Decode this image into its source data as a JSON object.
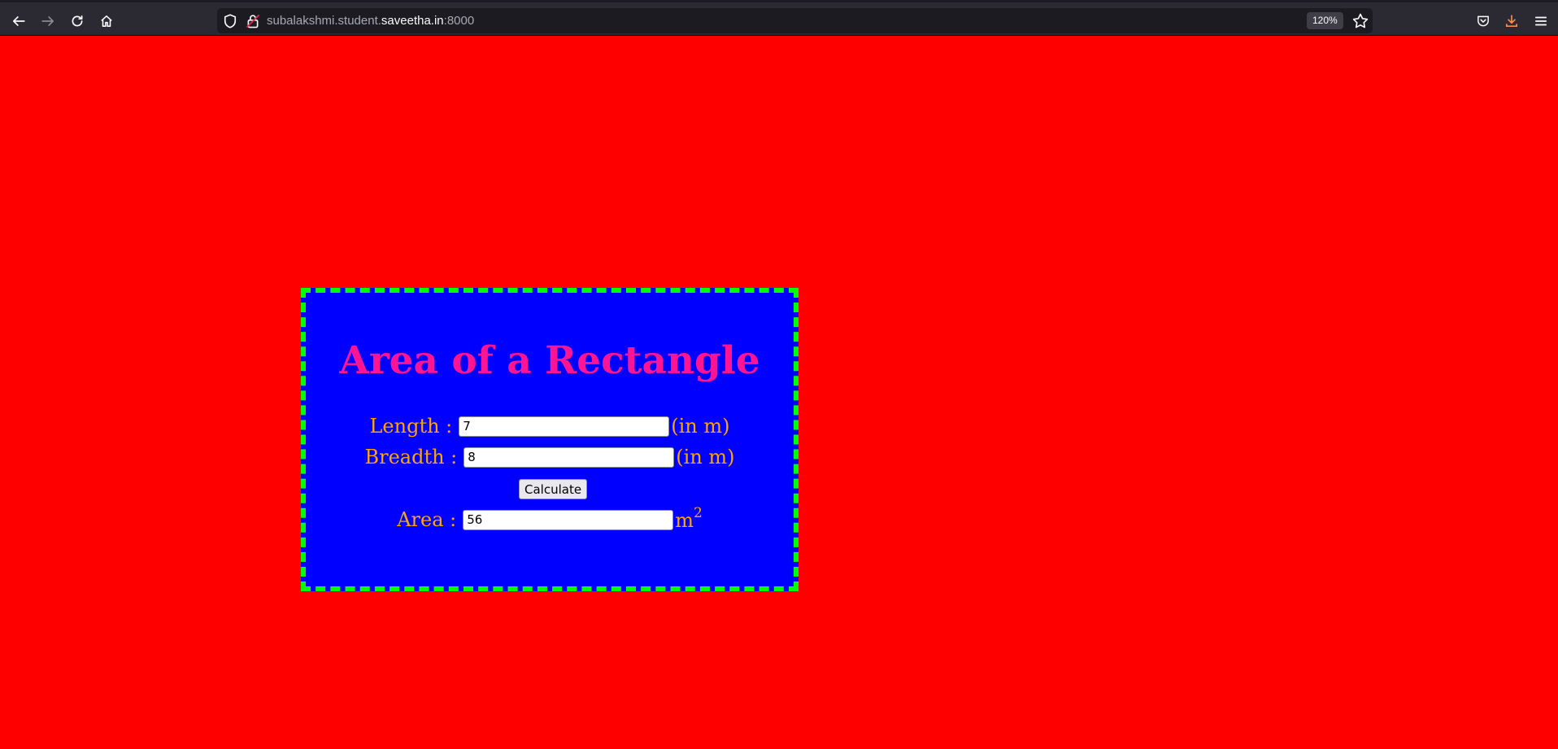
{
  "browser": {
    "url_host_prefix": "subalakshmi.student.",
    "url_host_domain": "saveetha.in",
    "url_port": ":8000",
    "zoom": "120%"
  },
  "form": {
    "title": "Area of a Rectangle",
    "length_label": "Length :",
    "length_value": "7",
    "length_unit": "(in m)",
    "breadth_label": "Breadth :",
    "breadth_value": "8",
    "breadth_unit": "(in m)",
    "calculate_label": "Calculate",
    "area_label": "Area :",
    "area_value": "56",
    "area_unit": "m",
    "area_unit_exponent": "2"
  },
  "colors": {
    "page_background": "#ff0000",
    "box_background": "#0000ff",
    "box_border": "#00ff00",
    "title_color": "#ff1493",
    "label_color": "#ffa500"
  }
}
